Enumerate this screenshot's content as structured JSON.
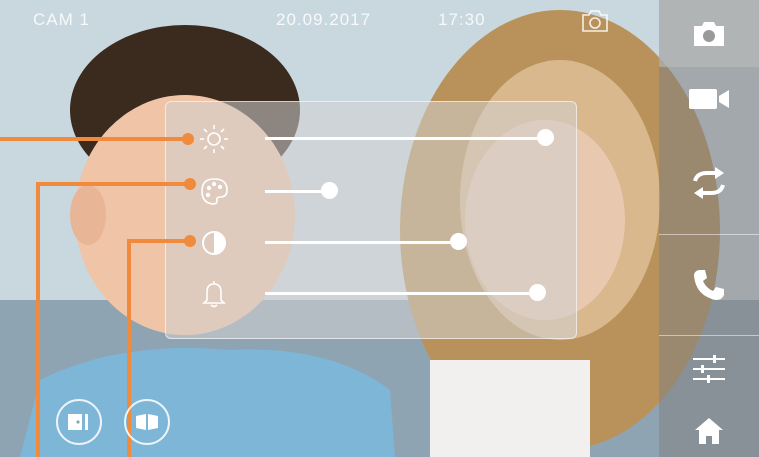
{
  "status": {
    "camera": "CAM 1",
    "date": "20.09.2017",
    "time": "17:30"
  },
  "sidebar": {
    "buttons": [
      {
        "name": "photo-button",
        "icon": "camera-icon"
      },
      {
        "name": "video-button",
        "icon": "video-camera-icon"
      },
      {
        "name": "switch-button",
        "icon": "switch-arrows-icon"
      },
      {
        "name": "call-button",
        "icon": "phone-icon"
      },
      {
        "name": "settings-button",
        "icon": "sliders-icon"
      },
      {
        "name": "home-button",
        "icon": "home-icon"
      }
    ]
  },
  "panel": {
    "sliders": [
      {
        "name": "brightness",
        "icon": "sun-icon",
        "level": 1.0
      },
      {
        "name": "color",
        "icon": "palette-icon",
        "level": 0.23
      },
      {
        "name": "contrast",
        "icon": "contrast-icon",
        "level": 0.69
      },
      {
        "name": "volume",
        "icon": "bell-icon",
        "level": 0.97
      }
    ]
  },
  "bottom_buttons": [
    {
      "name": "door-open-button",
      "icon": "door-open-icon"
    },
    {
      "name": "gate-open-button",
      "icon": "gate-open-icon"
    }
  ],
  "colors": {
    "accent": "#f08a3c",
    "slider": "#ffffff"
  }
}
